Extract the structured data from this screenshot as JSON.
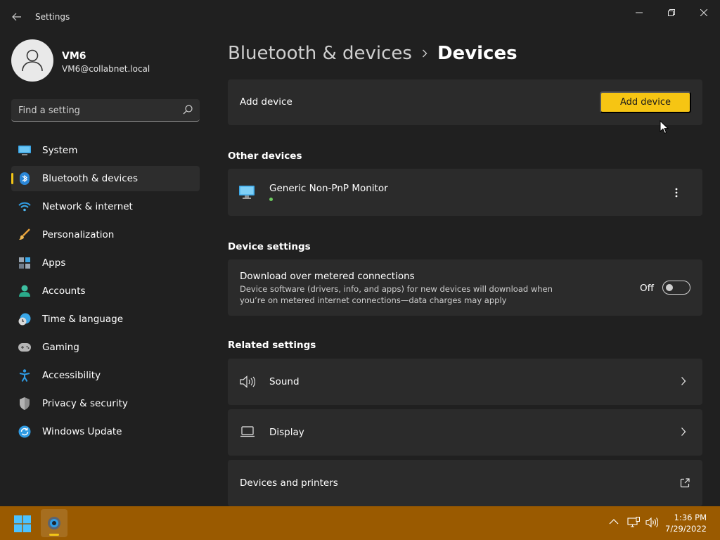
{
  "window": {
    "title": "Settings"
  },
  "profile": {
    "name": "VM6",
    "email": "VM6@collabnet.local"
  },
  "search": {
    "placeholder": "Find a setting"
  },
  "sidebar": {
    "items": [
      {
        "label": "System",
        "icon": "system-icon",
        "active": false
      },
      {
        "label": "Bluetooth & devices",
        "icon": "bluetooth-icon",
        "active": true
      },
      {
        "label": "Network & internet",
        "icon": "wifi-icon",
        "active": false
      },
      {
        "label": "Personalization",
        "icon": "paintbrush-icon",
        "active": false
      },
      {
        "label": "Apps",
        "icon": "apps-icon",
        "active": false
      },
      {
        "label": "Accounts",
        "icon": "accounts-icon",
        "active": false
      },
      {
        "label": "Time & language",
        "icon": "clock-globe-icon",
        "active": false
      },
      {
        "label": "Gaming",
        "icon": "gamepad-icon",
        "active": false
      },
      {
        "label": "Accessibility",
        "icon": "accessibility-icon",
        "active": false
      },
      {
        "label": "Privacy & security",
        "icon": "shield-icon",
        "active": false
      },
      {
        "label": "Windows Update",
        "icon": "update-icon",
        "active": false
      }
    ]
  },
  "breadcrumb": {
    "parent": "Bluetooth & devices",
    "current": "Devices"
  },
  "add_device": {
    "label": "Add device",
    "button_label": "Add device"
  },
  "other_devices": {
    "title": "Other devices",
    "devices": [
      {
        "name": "Generic Non-PnP Monitor",
        "icon": "monitor-icon",
        "status_color": "#6ccb5f"
      }
    ]
  },
  "device_settings": {
    "title": "Device settings",
    "metered": {
      "label": "Download over metered connections",
      "description": "Device software (drivers, info, and apps) for new devices will download when you’re on metered internet connections—data charges may apply",
      "state_label": "Off",
      "enabled": false
    }
  },
  "related_settings": {
    "title": "Related settings",
    "items": [
      {
        "label": "Sound",
        "icon": "speaker-icon",
        "action": "chevron-right-icon"
      },
      {
        "label": "Display",
        "icon": "laptop-icon",
        "action": "chevron-right-icon"
      },
      {
        "label": "Devices and printers",
        "icon": "",
        "action": "external-link-icon"
      }
    ]
  },
  "taskbar": {
    "time": "1:36 PM",
    "date": "7/29/2022",
    "color": "#9a5a00"
  },
  "colors": {
    "accent": "#f6c513",
    "background": "#202020",
    "card": "#2b2b2b"
  }
}
